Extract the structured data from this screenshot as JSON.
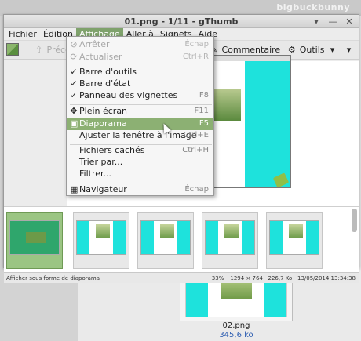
{
  "desktop": {
    "top_label": "bigbuckbunny",
    "file": {
      "name": "02.png",
      "size": "345,6 ko"
    }
  },
  "window": {
    "title": "01.png - 1/11 - gThumb",
    "controls": [
      "▾",
      "—",
      "✕"
    ]
  },
  "menubar": [
    "Fichier",
    "Édition",
    "Affichage",
    "Aller à",
    "Signets",
    "Aide"
  ],
  "active_menu_index": 2,
  "toolbar": {
    "prev_label": "Précéd",
    "comment_label": "Commentaire",
    "tools_label": "Outils"
  },
  "affichage_menu": [
    {
      "label": "Arrêter",
      "accel": "Échap",
      "disabled": true,
      "icon": "stop-icon"
    },
    {
      "label": "Actualiser",
      "accel": "Ctrl+R",
      "disabled": true,
      "icon": "refresh-icon"
    },
    {
      "label": "Barre d'outils",
      "accel": "",
      "checked": true
    },
    {
      "label": "Barre d'état",
      "accel": "",
      "checked": true
    },
    {
      "label": "Panneau des vignettes",
      "accel": "F8",
      "checked": true
    },
    {
      "label": "Plein écran",
      "accel": "F11",
      "icon": "fullscreen-icon"
    },
    {
      "label": "Diaporama",
      "accel": "F5",
      "highlighted": true,
      "icon": "slideshow-icon"
    },
    {
      "label": "Ajuster la fenêtre à l'image",
      "accel": "Ctrl+E"
    },
    {
      "label": "Fichiers cachés",
      "accel": "Ctrl+H"
    },
    {
      "label": "Trier par...",
      "accel": ""
    },
    {
      "label": "Filtrer...",
      "accel": ""
    },
    {
      "label": "Navigateur",
      "accel": "Échap",
      "icon": "navigator-icon"
    }
  ],
  "statusbar": {
    "left": "Afficher sous forme de diaporama",
    "zoom": "33%",
    "dimensions": "1294 × 764 · 226,7 Ko · 13/05/2014 13:34:38"
  },
  "colors": {
    "highlight": "#8cb073",
    "cyan": "#1ee2dc"
  }
}
